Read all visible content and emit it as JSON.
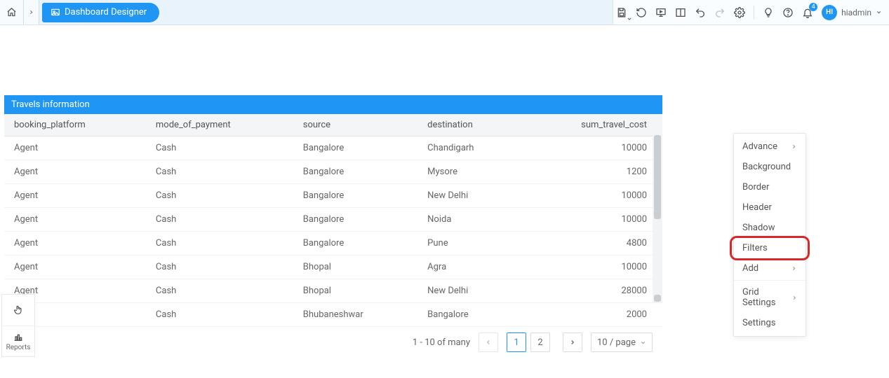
{
  "breadcrumb": {
    "current": "Dashboard Designer"
  },
  "header": {
    "notification_count": "4",
    "user": {
      "initials": "HI",
      "name": "hiadmin"
    }
  },
  "grid": {
    "title": "Travels information",
    "columns": [
      "booking_platform",
      "mode_of_payment",
      "source",
      "destination",
      "sum_travel_cost"
    ],
    "rows": [
      {
        "booking_platform": "Agent",
        "mode_of_payment": "Cash",
        "source": "Bangalore",
        "destination": "Chandigarh",
        "sum_travel_cost": "10000"
      },
      {
        "booking_platform": "Agent",
        "mode_of_payment": "Cash",
        "source": "Bangalore",
        "destination": "Mysore",
        "sum_travel_cost": "1200"
      },
      {
        "booking_platform": "Agent",
        "mode_of_payment": "Cash",
        "source": "Bangalore",
        "destination": "New Delhi",
        "sum_travel_cost": "10000"
      },
      {
        "booking_platform": "Agent",
        "mode_of_payment": "Cash",
        "source": "Bangalore",
        "destination": "Noida",
        "sum_travel_cost": "10000"
      },
      {
        "booking_platform": "Agent",
        "mode_of_payment": "Cash",
        "source": "Bangalore",
        "destination": "Pune",
        "sum_travel_cost": "4800"
      },
      {
        "booking_platform": "Agent",
        "mode_of_payment": "Cash",
        "source": "Bhopal",
        "destination": "Agra",
        "sum_travel_cost": "10000"
      },
      {
        "booking_platform": "Agent",
        "mode_of_payment": "Cash",
        "source": "Bhopal",
        "destination": "New Delhi",
        "sum_travel_cost": "28000"
      },
      {
        "booking_platform": "",
        "mode_of_payment": "Cash",
        "source": "Bhubaneshwar",
        "destination": "Bangalore",
        "sum_travel_cost": "2000"
      }
    ],
    "footer": {
      "range_text": "1 - 10 of many",
      "pages": [
        "1",
        "2"
      ],
      "current_page": "1",
      "page_size_label": "10 / page"
    }
  },
  "dock": {
    "reports_label": "Reports"
  },
  "context_menu": {
    "items": [
      {
        "label": "Advance",
        "submenu": true
      },
      {
        "label": "Background",
        "submenu": false
      },
      {
        "label": "Border",
        "submenu": false
      },
      {
        "label": "Header",
        "submenu": false
      },
      {
        "label": "Shadow",
        "submenu": false
      },
      {
        "label": "Filters",
        "submenu": false,
        "highlight": true
      },
      {
        "label": "Add",
        "submenu": true
      },
      {
        "label": "Grid Settings",
        "submenu": true,
        "sep": true
      },
      {
        "label": "Settings",
        "submenu": false
      }
    ]
  }
}
